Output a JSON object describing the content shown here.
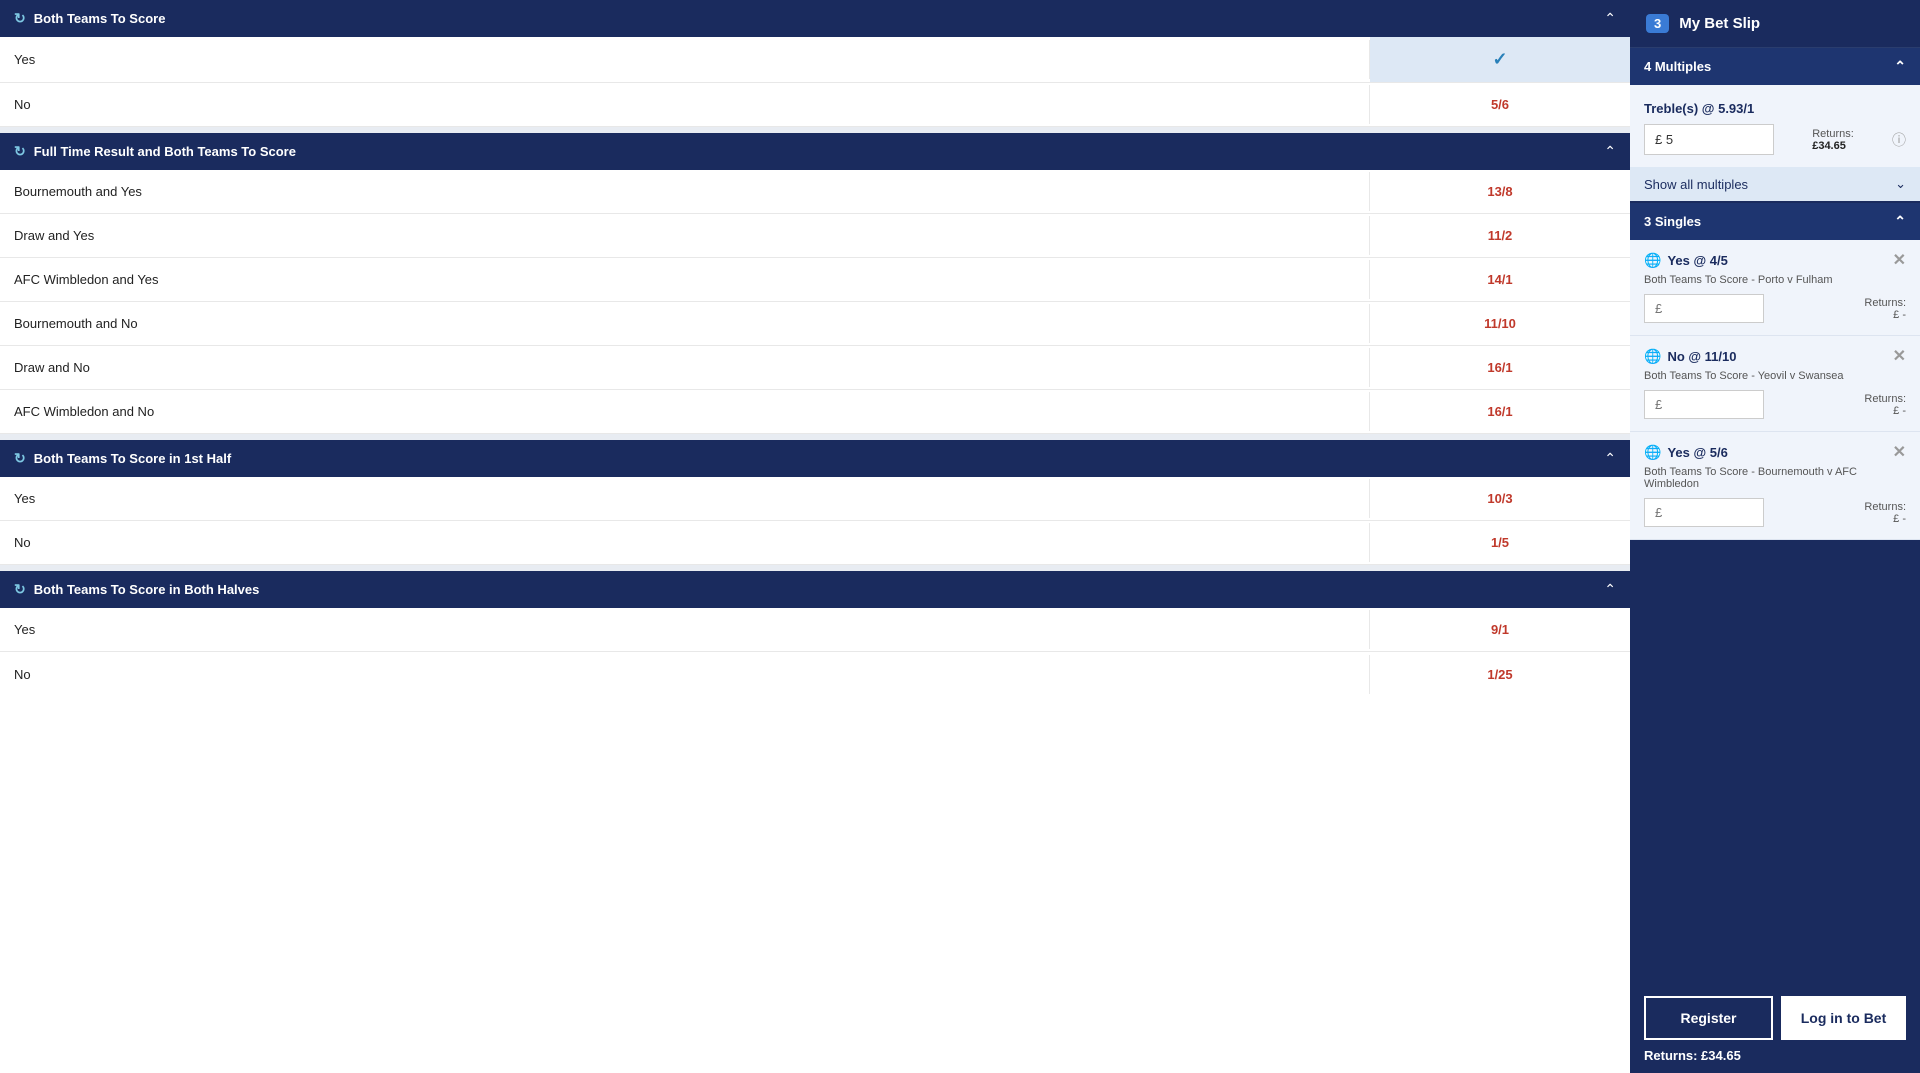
{
  "sections": [
    {
      "id": "both-teams-to-score",
      "title": "Both Teams To Score",
      "bets": [
        {
          "label": "Yes",
          "odds": "",
          "selected": true
        },
        {
          "label": "No",
          "odds": "5/6",
          "selected": false
        }
      ]
    },
    {
      "id": "full-time-result-bts",
      "title": "Full Time Result and Both Teams To Score",
      "bets": [
        {
          "label": "Bournemouth and Yes",
          "odds": "13/8",
          "selected": false
        },
        {
          "label": "Draw and Yes",
          "odds": "11/2",
          "selected": false
        },
        {
          "label": "AFC Wimbledon and Yes",
          "odds": "14/1",
          "selected": false
        },
        {
          "label": "Bournemouth and No",
          "odds": "11/10",
          "selected": false
        },
        {
          "label": "Draw and No",
          "odds": "16/1",
          "selected": false
        },
        {
          "label": "AFC Wimbledon and No",
          "odds": "16/1",
          "selected": false
        }
      ]
    },
    {
      "id": "bts-1st-half",
      "title": "Both Teams To Score in 1st Half",
      "bets": [
        {
          "label": "Yes",
          "odds": "10/3",
          "selected": false
        },
        {
          "label": "No",
          "odds": "1/5",
          "selected": false
        }
      ]
    },
    {
      "id": "bts-both-halves",
      "title": "Both Teams To Score in Both Halves",
      "bets": [
        {
          "label": "Yes",
          "odds": "9/1",
          "selected": false
        },
        {
          "label": "No",
          "odds": "1/25",
          "selected": false
        }
      ]
    }
  ],
  "betslip": {
    "header": {
      "badge": "3",
      "title": "My Bet Slip"
    },
    "multiples": {
      "header": "4 Multiples",
      "treble_label": "Treble(s) @ 5.93/1",
      "stake_value": "£ 5",
      "stake_placeholder": "£ 5",
      "returns_label": "Returns:",
      "returns_value": "£34.65",
      "show_multiples": "Show all multiples"
    },
    "singles": {
      "header": "3 Singles",
      "items": [
        {
          "title": "Yes @ 4/5",
          "description": "Both Teams To Score - Porto v Fulham",
          "stake_placeholder": "£",
          "returns_label": "Returns:",
          "returns_value": "£ -"
        },
        {
          "title": "No @ 11/10",
          "description": "Both Teams To Score - Yeovil v Swansea",
          "stake_placeholder": "£",
          "returns_label": "Returns:",
          "returns_value": "£ -"
        },
        {
          "title": "Yes @ 5/6",
          "description": "Both Teams To Score - Bournemouth v AFC Wimbledon",
          "stake_placeholder": "£",
          "returns_label": "Returns:",
          "returns_value": "£ -"
        }
      ]
    },
    "footer": {
      "register_label": "Register",
      "login_label": "Log in to Bet",
      "total_returns": "Returns: £34.65"
    }
  }
}
